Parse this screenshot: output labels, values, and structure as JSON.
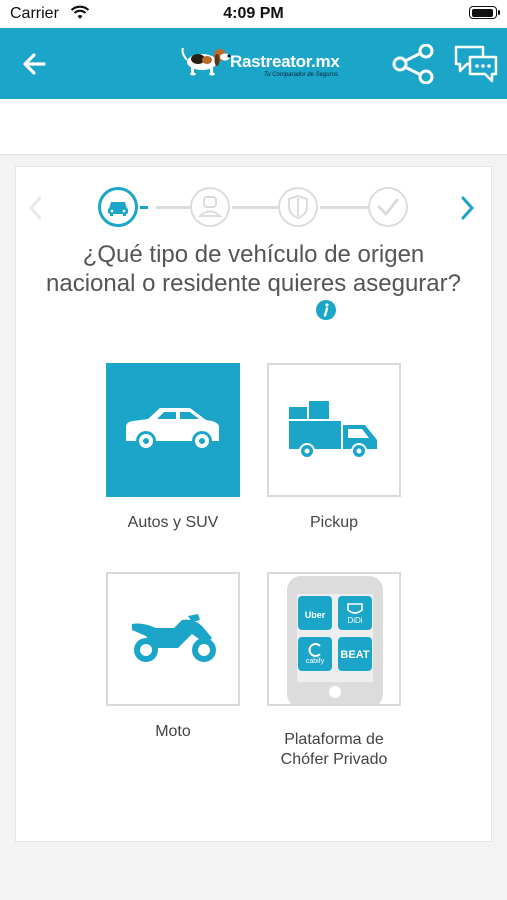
{
  "status_bar": {
    "carrier": "Carrier",
    "time": "4:09 PM",
    "battery_level": 0.95
  },
  "header": {
    "brand": "Rastreator",
    "brand_suffix": ".mx",
    "tagline": "Tu Comparador de Seguros"
  },
  "question": {
    "text": "¿Qué tipo de vehículo de origen nacional o residente quieres asegurar?"
  },
  "progress": {
    "current_step": 1,
    "total_steps": 4
  },
  "options": [
    {
      "label": "Autos y SUV",
      "selected": true
    },
    {
      "label": "Pickup",
      "selected": false
    },
    {
      "label": "Moto",
      "selected": false
    },
    {
      "label": "Plataforma de Chófer Privado",
      "selected": false
    }
  ],
  "platform_apps": [
    "Uber",
    "DiDi",
    "cabify",
    "BEAT"
  ],
  "colors": {
    "brand": "#1aa5c9",
    "text": "#555555",
    "inactive": "#dcdcdc"
  }
}
